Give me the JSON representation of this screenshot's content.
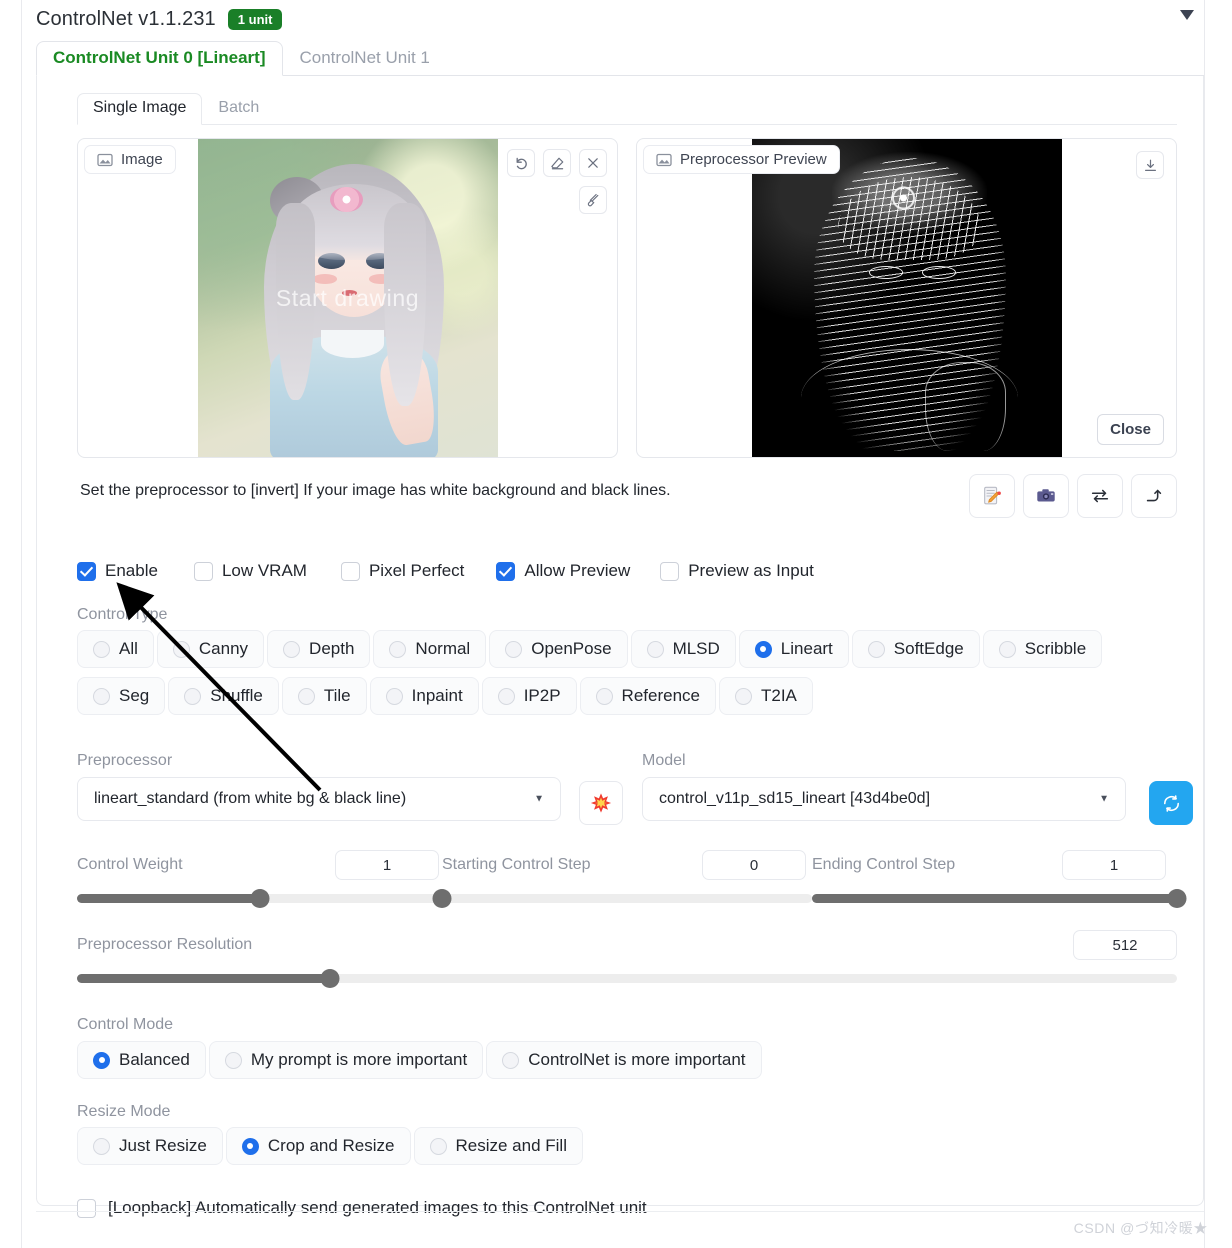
{
  "header": {
    "title": "ControlNet v1.1.231",
    "unit_badge": "1 unit",
    "collapse_icon": "triangle-down-icon",
    "badge_color": "#1a7f28"
  },
  "unit_tabs": [
    {
      "label": "ControlNet Unit 0 [Lineart]",
      "active": true
    },
    {
      "label": "ControlNet Unit 1",
      "active": false
    }
  ],
  "inner_tabs": [
    {
      "label": "Single Image",
      "active": true
    },
    {
      "label": "Batch",
      "active": false
    }
  ],
  "image_panel": {
    "tag": "Image",
    "tag_icon": "image-icon",
    "watermark": "Start drawing",
    "tools": [
      {
        "name": "undo-icon",
        "glyph": "↺"
      },
      {
        "name": "eraser-icon",
        "glyph": "◇"
      },
      {
        "name": "close-icon",
        "glyph": "✕"
      },
      {
        "name": "brush-icon",
        "glyph": "✎"
      }
    ]
  },
  "preview_panel": {
    "tag": "Preprocessor Preview",
    "tag_icon": "image-icon",
    "download_icon": "download-icon",
    "close_label": "Close"
  },
  "hint": {
    "text": "Set the preprocessor to [invert] If your image has white background and black lines.",
    "buttons": [
      {
        "name": "send-to-txt2img-icon",
        "glyph": "📝"
      },
      {
        "name": "webcam-icon",
        "glyph": "📷"
      },
      {
        "name": "swap-icon",
        "glyph": "⇄"
      },
      {
        "name": "send-dimensions-icon",
        "glyph": "⤴"
      }
    ]
  },
  "checkboxes": [
    {
      "label": "Enable",
      "checked": true
    },
    {
      "label": "Low VRAM",
      "checked": false
    },
    {
      "label": "Pixel Perfect",
      "checked": false
    },
    {
      "label": "Allow Preview",
      "checked": true
    },
    {
      "label": "Preview as Input",
      "checked": false
    }
  ],
  "control_type": {
    "label": "Control Type",
    "selected": "Lineart",
    "row1": [
      "All",
      "Canny",
      "Depth",
      "Normal",
      "OpenPose",
      "MLSD",
      "Lineart",
      "SoftEdge",
      "Scribble"
    ],
    "row2": [
      "Seg",
      "Shuffle",
      "Tile",
      "Inpaint",
      "IP2P",
      "Reference",
      "T2IA"
    ]
  },
  "preprocessor": {
    "label": "Preprocessor",
    "value": "lineart_standard (from white bg & black line)",
    "run_icon": "explosion-icon"
  },
  "model": {
    "label": "Model",
    "value": "control_v11p_sd15_lineart [43d4be0d]",
    "refresh_icon": "refresh-icon"
  },
  "sliders": [
    {
      "name": "Control Weight",
      "value": "1",
      "pct": 50
    },
    {
      "name": "Starting Control Step",
      "value": "0",
      "pct": 0
    },
    {
      "name": "Ending Control Step",
      "value": "1",
      "pct": 100
    },
    {
      "name": "Preprocessor Resolution",
      "value": "512",
      "pct": 23
    }
  ],
  "control_mode": {
    "label": "Control Mode",
    "selected": "Balanced",
    "options": [
      "Balanced",
      "My prompt is more important",
      "ControlNet is more important"
    ]
  },
  "resize_mode": {
    "label": "Resize Mode",
    "selected": "Crop and Resize",
    "options": [
      "Just Resize",
      "Crop and Resize",
      "Resize and Fill"
    ]
  },
  "loopback": {
    "label": "[Loopback] Automatically send generated images to this ControlNet unit",
    "checked": false
  },
  "watermark": "CSDN @づ知冷暖★",
  "colors": {
    "accent": "#1f6feb",
    "green": "#1a8a23",
    "slider": "#6e6e6e"
  }
}
